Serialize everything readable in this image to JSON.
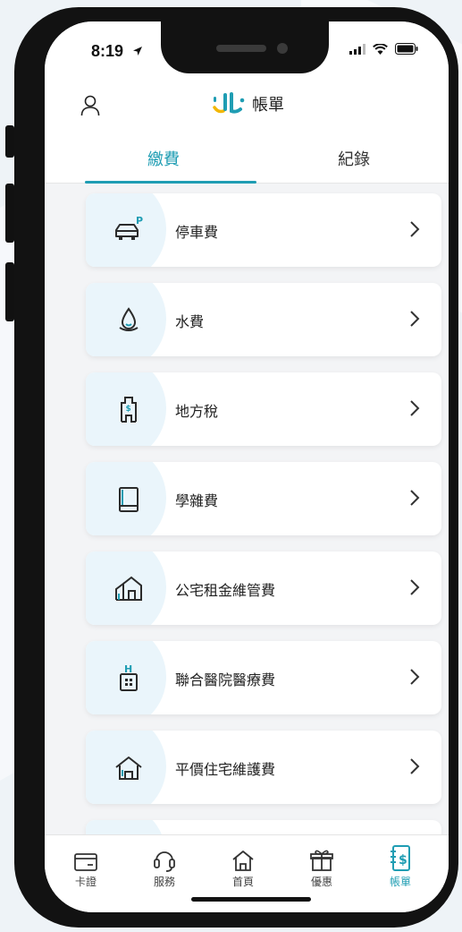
{
  "status_bar": {
    "time": "8:19"
  },
  "header": {
    "title": "帳單"
  },
  "tabs": [
    {
      "label": "繳費",
      "active": true
    },
    {
      "label": "紀錄",
      "active": false
    }
  ],
  "bills": [
    {
      "label": "停車費",
      "icon": "car-parking-icon"
    },
    {
      "label": "水費",
      "icon": "water-drop-icon"
    },
    {
      "label": "地方稅",
      "icon": "tax-building-icon"
    },
    {
      "label": "學雜費",
      "icon": "book-icon"
    },
    {
      "label": "公宅租金維管費",
      "icon": "public-housing-icon"
    },
    {
      "label": "聯合醫院醫療費",
      "icon": "hospital-icon"
    },
    {
      "label": "平價住宅維護費",
      "icon": "house-icon"
    }
  ],
  "bottom_nav": [
    {
      "label": "卡證",
      "icon": "card-icon",
      "active": false
    },
    {
      "label": "服務",
      "icon": "headset-icon",
      "active": false
    },
    {
      "label": "首頁",
      "icon": "home-icon",
      "active": false
    },
    {
      "label": "優惠",
      "icon": "gift-icon",
      "active": false
    },
    {
      "label": "帳單",
      "icon": "bill-icon",
      "active": true
    }
  ],
  "colors": {
    "accent": "#1f9db3",
    "icon_dark": "#2b2b2b",
    "card_bg": "#ffffff",
    "screen_bg": "#f3f4f6"
  }
}
